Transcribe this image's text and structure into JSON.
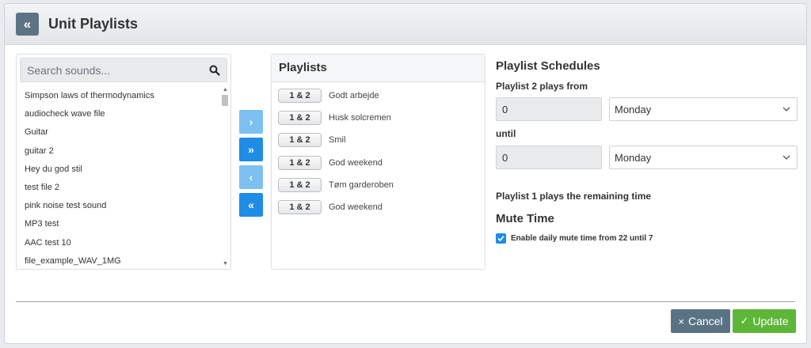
{
  "header": {
    "back_glyph": "«",
    "title": "Unit Playlists"
  },
  "sounds": {
    "search_placeholder": "Search sounds...",
    "items": [
      "Simpson laws of thermodynamics",
      "audiocheck wave file",
      "Guitar",
      "guitar 2",
      "Hey du god stil",
      "test file 2",
      "pink noise test sound",
      "MP3 test",
      "AAC test 10",
      "file_example_WAV_1MG"
    ]
  },
  "move_buttons": {
    "add_one": "›",
    "add_all": "»",
    "remove_one": "‹",
    "remove_all": "«"
  },
  "playlists": {
    "title": "Playlists",
    "items": [
      {
        "badge": "1 & 2",
        "name": "Godt arbejde"
      },
      {
        "badge": "1 & 2",
        "name": "Husk solcremen"
      },
      {
        "badge": "1 & 2",
        "name": "Smil"
      },
      {
        "badge": "1 & 2",
        "name": "God weekend"
      },
      {
        "badge": "1 & 2",
        "name": "Tøm garderoben"
      },
      {
        "badge": "1 & 2",
        "name": "God weekend"
      }
    ]
  },
  "schedule": {
    "title": "Playlist Schedules",
    "from_label": "Playlist 2 plays from",
    "from_hour": "0",
    "from_day": "Monday",
    "until_label": "until",
    "until_hour": "0",
    "until_day": "Monday",
    "remaining_text": "Playlist 1 plays the remaining time",
    "mute_title": "Mute Time",
    "mute_checkbox_label": "Enable daily mute time from 22 until 7",
    "mute_checked": true
  },
  "footer": {
    "cancel_label": "Cancel",
    "cancel_glyph": "×",
    "update_label": "Update",
    "update_glyph": "✓"
  },
  "colors": {
    "primary_blue": "#1f8ce6",
    "light_blue": "#7cc0f2",
    "cancel_gray": "#5a7384",
    "update_green": "#5db638"
  }
}
